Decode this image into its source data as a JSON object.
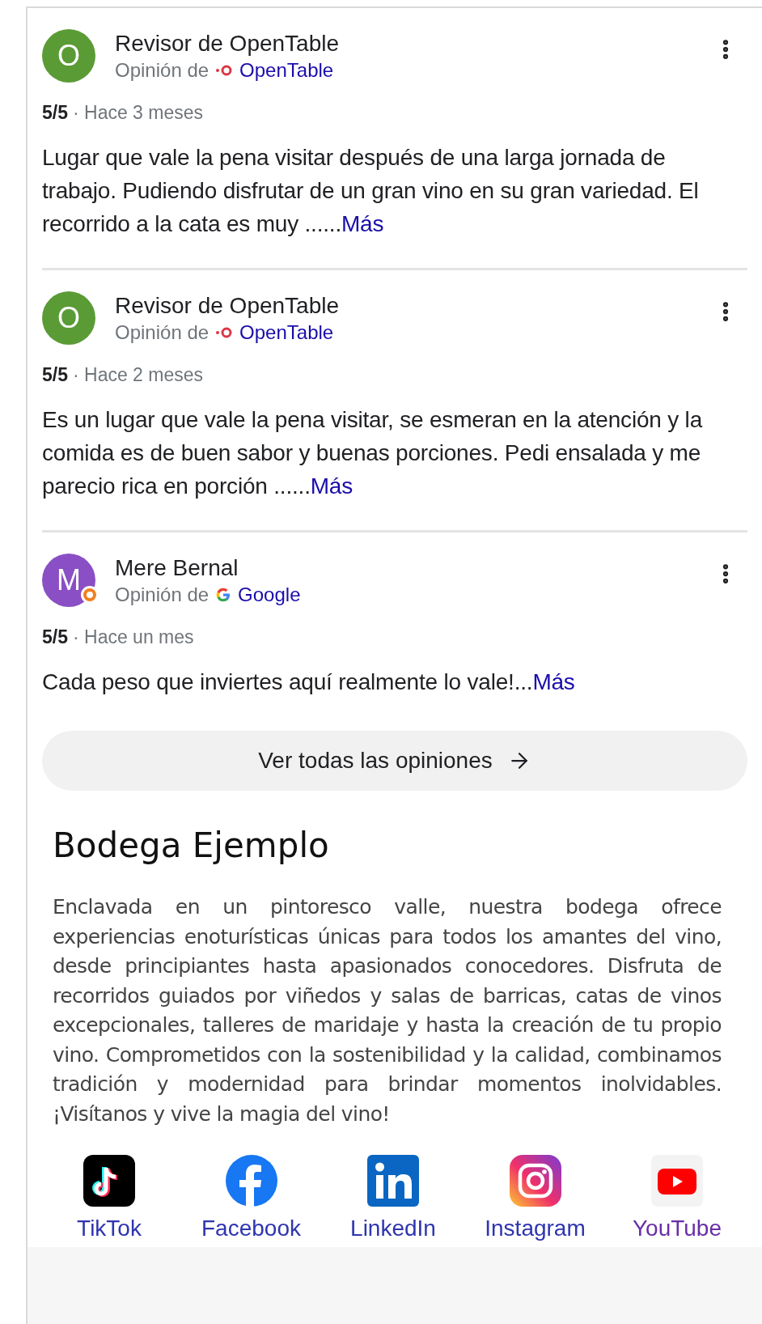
{
  "reviews": [
    {
      "author": "Revisor de OpenTable",
      "avatar": {
        "letter": "O",
        "color": "#5a9b35",
        "badge": false
      },
      "source_prefix": "Opinión de",
      "source": {
        "kind": "opentable",
        "name": "OpenTable"
      },
      "rating": "5/5",
      "time": "· Hace 3 meses",
      "text": "Lugar que vale la pena visitar después de una larga jornada de trabajo. Pudiendo disfrutar de un gran vino en su gran variedad. El recorrido a la cata es muy ......",
      "more": "Más"
    },
    {
      "author": "Revisor de OpenTable",
      "avatar": {
        "letter": "O",
        "color": "#5a9b35",
        "badge": false
      },
      "source_prefix": "Opinión de",
      "source": {
        "kind": "opentable",
        "name": "OpenTable"
      },
      "rating": "5/5",
      "time": "· Hace 2 meses",
      "text": "Es un lugar que vale la pena visitar, se esmeran en la atención y la comida es de buen sabor y buenas porciones. Pedi ensalada y me parecio rica en porción ......",
      "more": "Más"
    },
    {
      "author": "Mere Bernal",
      "avatar": {
        "letter": "M",
        "color": "#8a4fc4",
        "badge": true
      },
      "source_prefix": "Opinión de",
      "source": {
        "kind": "google",
        "name": "Google"
      },
      "rating": "5/5",
      "time": "· Hace un mes",
      "text": "Cada peso que inviertes aquí realmente lo vale!...",
      "more": "Más"
    }
  ],
  "all_reviews_button": "Ver todas las opiniones",
  "business": {
    "name": "Bodega Ejemplo",
    "description": "Enclavada en un pintoresco valle, nuestra bodega ofrece experiencias enoturísticas únicas para todos los amantes del vino, desde principiantes hasta apasionados conocedores. Disfruta de recorridos guiados por viñedos y salas de barricas, catas de vinos excepcionales, talleres de maridaje y hasta la creación de tu propio vino. Comprometidos con la sostenibilidad y la calidad, combinamos tradición y modernidad para brindar momentos inolvidables. ¡Visítanos y vive la magia del vino!"
  },
  "social": [
    {
      "kind": "tiktok",
      "label": "TikTok",
      "visited": false
    },
    {
      "kind": "facebook",
      "label": "Facebook",
      "visited": false
    },
    {
      "kind": "linkedin",
      "label": "LinkedIn",
      "visited": false
    },
    {
      "kind": "instagram",
      "label": "Instagram",
      "visited": false
    },
    {
      "kind": "youtube",
      "label": "YouTube",
      "visited": true
    }
  ]
}
